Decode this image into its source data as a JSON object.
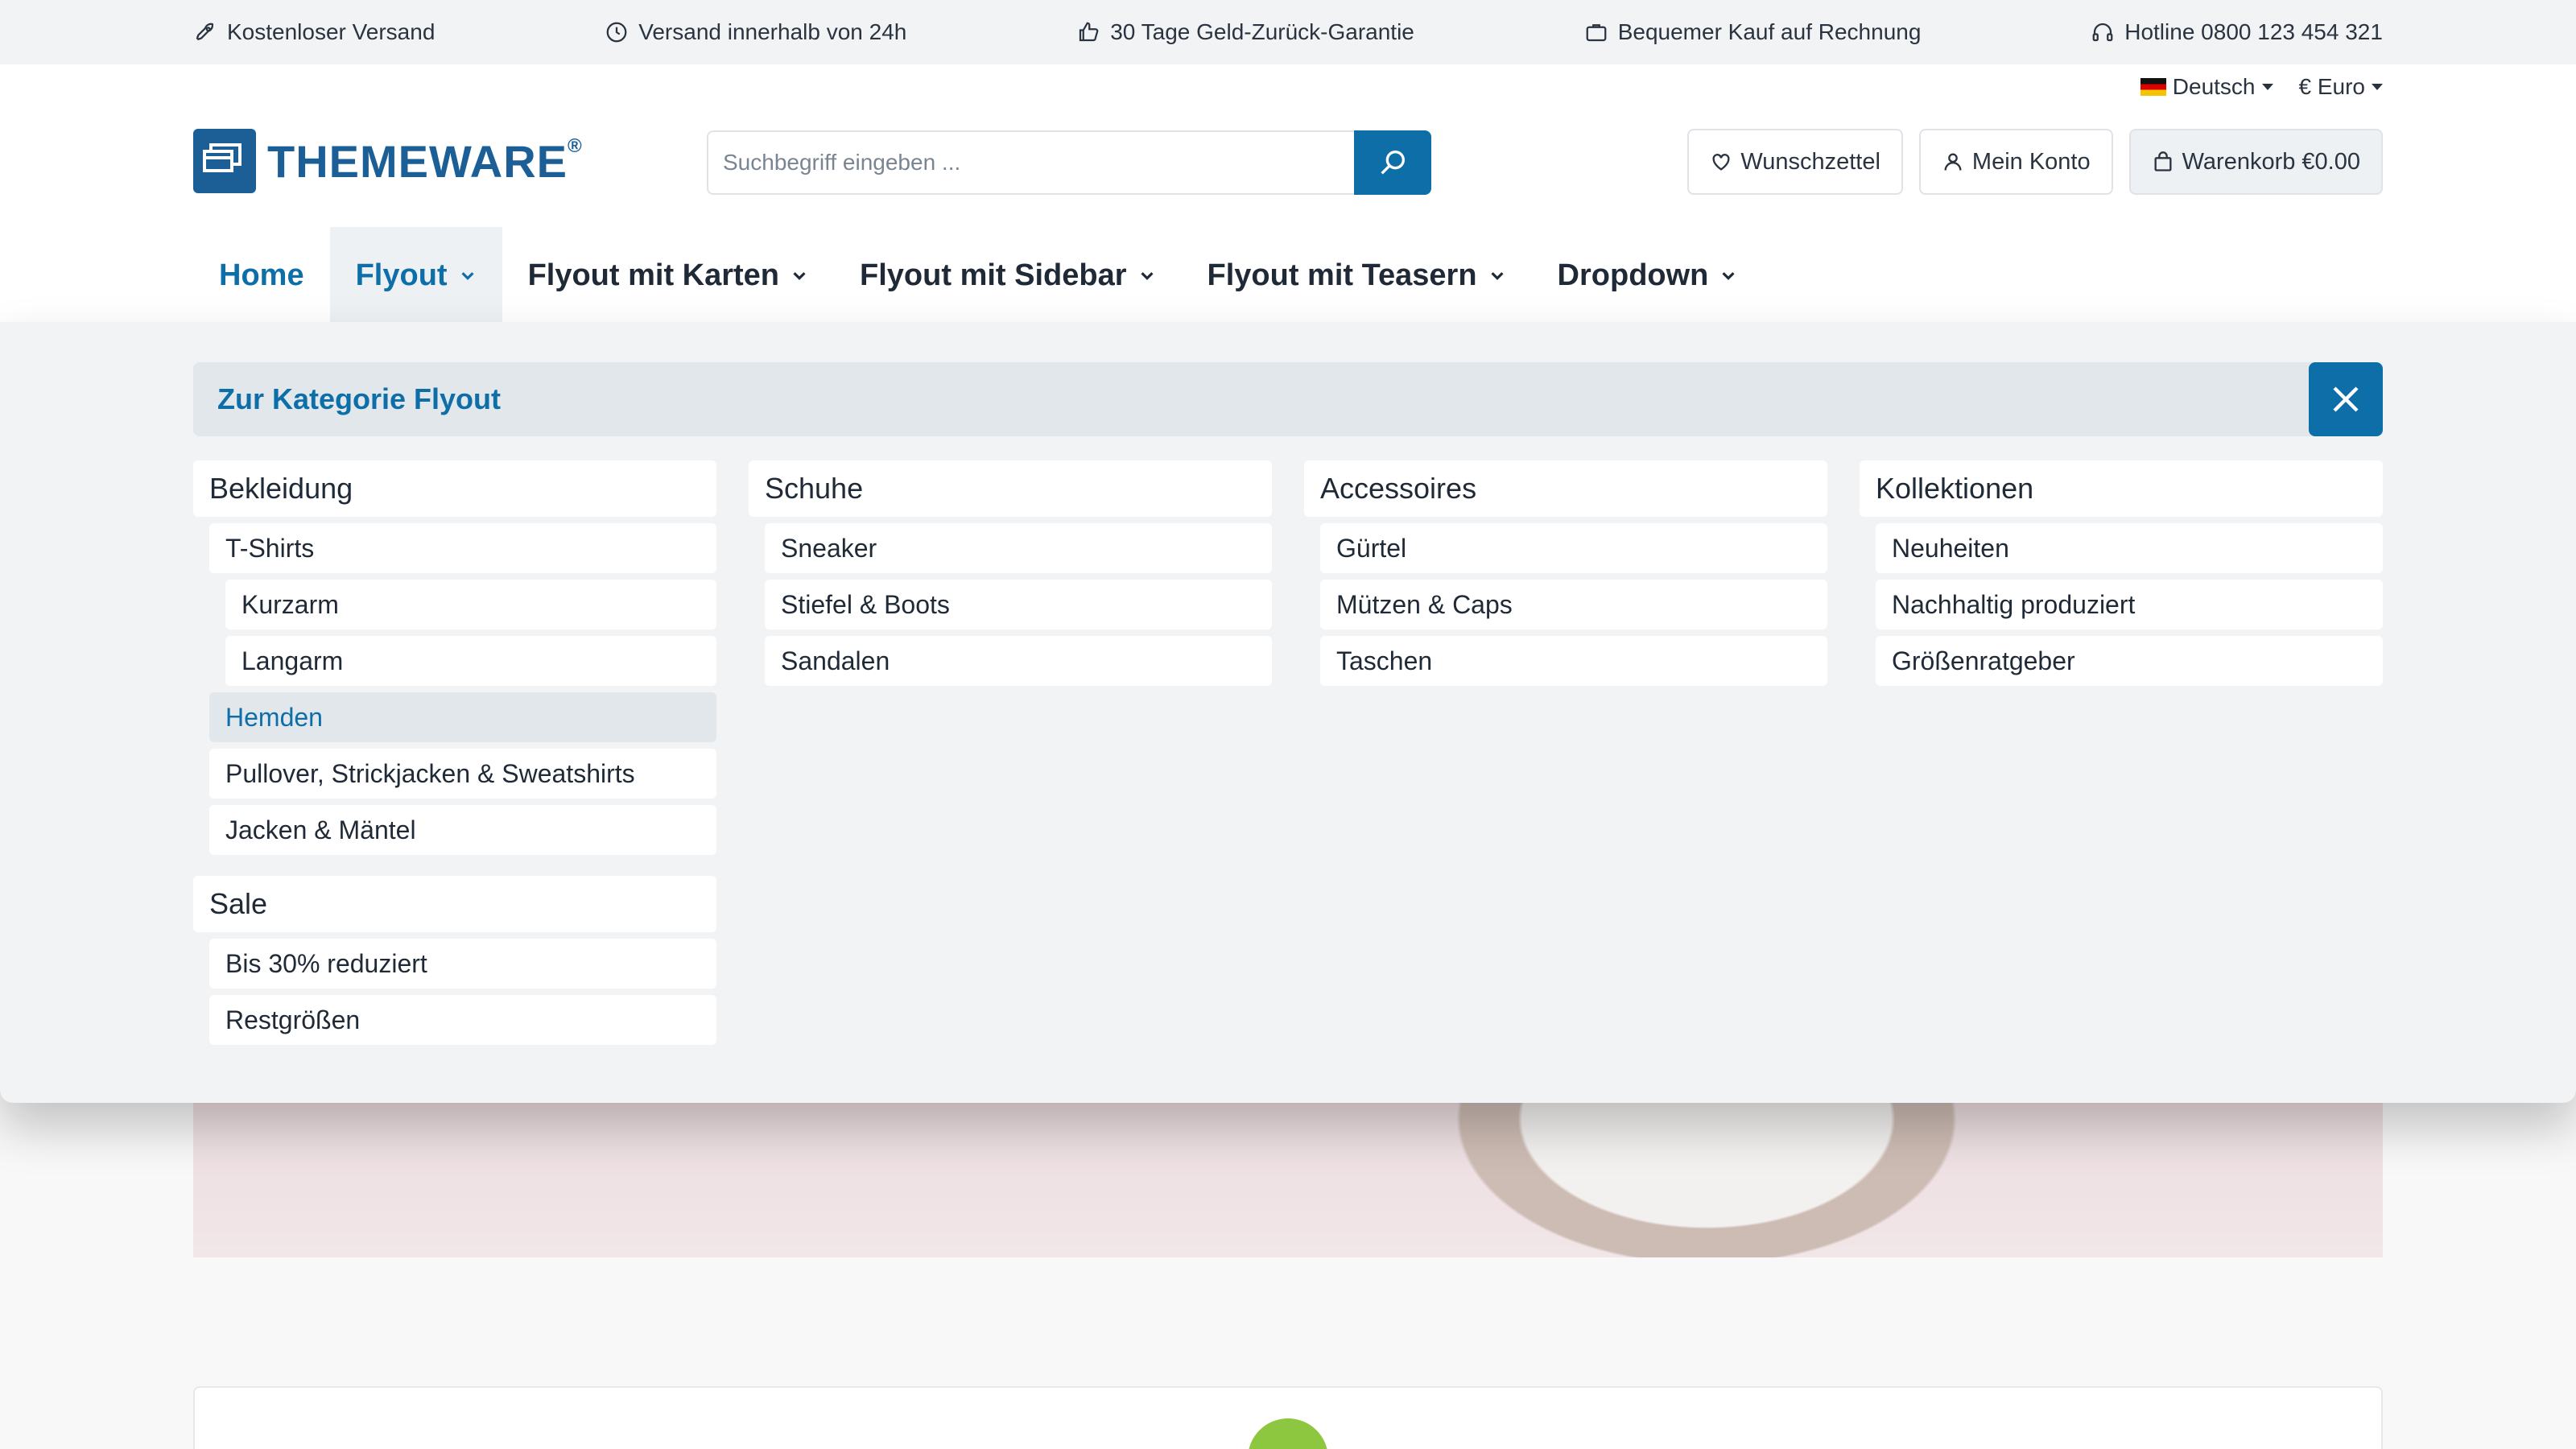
{
  "topbar": {
    "items": [
      {
        "icon": "rocket-icon",
        "label": "Kostenloser Versand"
      },
      {
        "icon": "clock-icon",
        "label": "Versand innerhalb von 24h"
      },
      {
        "icon": "thumbs-up-icon",
        "label": "30 Tage Geld-Zurück-Garantie"
      },
      {
        "icon": "briefcase-icon",
        "label": "Bequemer Kauf auf Rechnung"
      },
      {
        "icon": "headset-icon",
        "label": "Hotline 0800 123 454 321"
      }
    ]
  },
  "locale": {
    "language": "Deutsch",
    "currency": "€ Euro"
  },
  "brand": {
    "name": "THEMEWARE",
    "registered": "®",
    "color": "#1b5f96"
  },
  "search": {
    "placeholder": "Suchbegriff eingeben ..."
  },
  "actions": {
    "wishlist": "Wunschzettel",
    "account": "Mein Konto",
    "cart": "Warenkorb €0.00"
  },
  "nav": {
    "items": [
      {
        "label": "Home"
      },
      {
        "label": "Flyout"
      },
      {
        "label": "Flyout mit Karten"
      },
      {
        "label": "Flyout mit Sidebar"
      },
      {
        "label": "Flyout mit Teasern"
      },
      {
        "label": "Dropdown"
      }
    ]
  },
  "flyout": {
    "header": "Zur Kategorie Flyout",
    "columns": [
      {
        "title": "Bekleidung",
        "items": [
          "T-Shirts",
          "Kurzarm",
          "Langarm",
          "Hemden",
          "Pullover, Strickjacken & Sweatshirts",
          "Jacken & Mäntel"
        ],
        "title2": "Sale",
        "items2": [
          "Bis 30% reduziert",
          "Restgrößen"
        ]
      },
      {
        "title": "Schuhe",
        "items": [
          "Sneaker",
          "Stiefel & Boots",
          "Sandalen"
        ]
      },
      {
        "title": "Accessoires",
        "items": [
          "Gürtel",
          "Mützen & Caps",
          "Taschen"
        ]
      },
      {
        "title": "Kollektionen",
        "items": [
          "Neuheiten",
          "Nachhaltig produziert",
          "Größenratgeber"
        ]
      }
    ]
  },
  "colors": {
    "accent": "#0d6ea8",
    "topbar_bg": "#f2f3f5",
    "flyout_bg": "#f2f3f5"
  }
}
